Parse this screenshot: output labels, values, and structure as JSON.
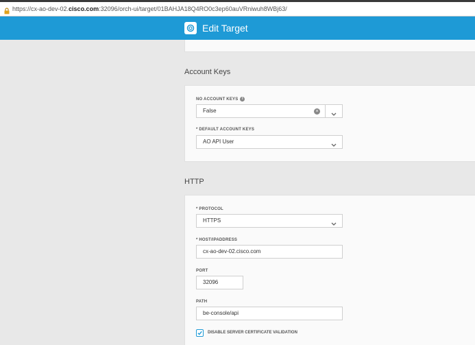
{
  "browser": {
    "url_prefix": "https://cx-ao-dev-02.",
    "url_domain": "cisco.com",
    "url_suffix": ":32096/orch-ui/target/01BAHJA18Q4RO0c3ep60auVRniwuh8WBj63/"
  },
  "header": {
    "title": "Edit Target",
    "icon": "target-settings-icon"
  },
  "account_keys": {
    "section_title": "Account Keys",
    "no_account_keys": {
      "label": "NO ACCOUNT KEYS",
      "value": "False"
    },
    "default_account_keys": {
      "label": "* DEFAULT ACCOUNT KEYS",
      "value": "AO API User"
    }
  },
  "http": {
    "section_title": "HTTP",
    "protocol": {
      "label": "* PROTOCOL",
      "value": "HTTPS"
    },
    "host": {
      "label": "* HOST/IPADDRESS",
      "value": "cx-ao-dev-02.cisco.com"
    },
    "port": {
      "label": "PORT",
      "value": "32096"
    },
    "path": {
      "label": "PATH",
      "value": "be-console/api"
    },
    "disable_cert_validation": {
      "label": "DISABLE SERVER CERTIFICATE VALIDATION",
      "checked": true
    }
  },
  "colors": {
    "header": "#1e9ad6",
    "background": "#e8e8e8",
    "card": "#fafafa"
  }
}
